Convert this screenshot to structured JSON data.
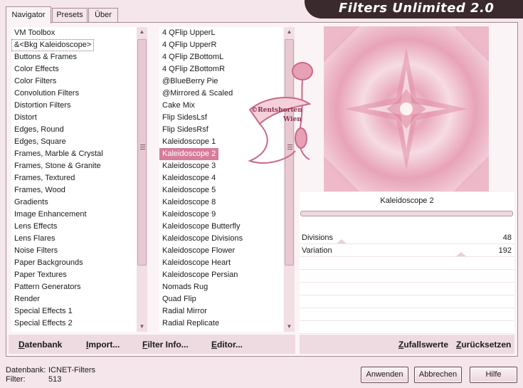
{
  "app": {
    "title": "Filters Unlimited 2.0"
  },
  "tabs": [
    {
      "label": "Navigator"
    },
    {
      "label": "Presets"
    },
    {
      "label": "Über"
    }
  ],
  "categories": {
    "items": [
      "VM Toolbox",
      "&<Bkg Kaleidoscope>",
      "Buttons & Frames",
      "Color Effects",
      "Color Filters",
      "Convolution Filters",
      "Distortion Filters",
      "Distort",
      "Edges, Round",
      "Edges, Square",
      "Frames, Marble & Crystal",
      "Frames, Stone & Granite",
      "Frames, Textured",
      "Frames, Wood",
      "Gradients",
      "Image Enhancement",
      "Lens Effects",
      "Lens Flares",
      "Noise Filters",
      "Paper Backgrounds",
      "Paper Textures",
      "Pattern Generators",
      "Render",
      "Special Effects 1",
      "Special Effects 2"
    ],
    "selected_index": 1
  },
  "filters": {
    "items": [
      "4 QFlip UpperL",
      "4 QFlip UpperR",
      "4 QFlip ZBottomL",
      "4 QFlip ZBottomR",
      "@BlueBerry Pie",
      "@Mirrored & Scaled",
      "Cake Mix",
      "Flip SidesLsf",
      "Flip SidesRsf",
      "Kaleidoscope 1",
      "Kaleidoscope 2",
      "Kaleidoscope 3",
      "Kaleidoscope 4",
      "Kaleidoscope 5",
      "Kaleidoscope 8",
      "Kaleidoscope 9",
      "Kaleidoscope Butterfly",
      "Kaleidoscope Divisions",
      "Kaleidoscope Flower",
      "Kaleidoscope Heart",
      "Kaleidoscope Persian",
      "Nomads Rug",
      "Quad Flip",
      "Radial Mirror",
      "Radial Replicate"
    ],
    "selected_index": 10
  },
  "links": {
    "database": "Datenbank",
    "import": "Import...",
    "filter_info": "Filter Info...",
    "editor": "Editor...",
    "randomize": "Zufallswerte",
    "reset": "Zurücksetzen"
  },
  "params": {
    "filter_name": "Kaleidoscope 2",
    "rows": [
      {
        "label": "Divisions",
        "value": "48"
      },
      {
        "label": "Variation",
        "value": "192"
      }
    ]
  },
  "watermark": {
    "line1": "©Rentshorten",
    "line2": "Wien"
  },
  "info": {
    "database_label": "Datenbank:",
    "database_value": "ICNET-Filters",
    "filter_label": "Filter:",
    "filter_value": "513"
  },
  "buttons": {
    "apply": "Anwenden",
    "cancel": "Abbrechen",
    "help": "Hilfe"
  },
  "colors": {
    "accent": "#d67d9b",
    "panel": "#fbf4f6",
    "background": "#f4e6ea",
    "banner": "#3a2a2e"
  }
}
